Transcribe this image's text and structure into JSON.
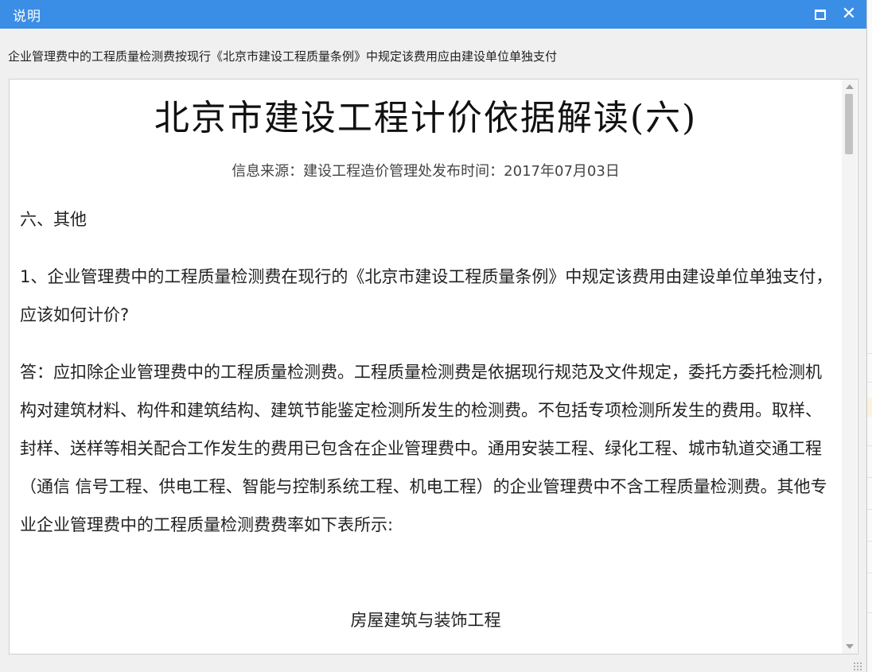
{
  "window": {
    "title": "说明",
    "maximize_icon": "maximize-icon",
    "close_icon": "close-icon",
    "close_glyph": "✕"
  },
  "description": "企业管理费中的工程质量检测费按现行《北京市建设工程质量条例》中规定该费用应由建设单位单独支付",
  "document": {
    "title": "北京市建设工程计价依据解读(六)",
    "source": "信息来源：建设工程造价管理处发布时间：2017年07月03日",
    "section": "六、其他",
    "question": "1、企业管理费中的工程质量检测费在现行的《北京市建设工程质量条例》中规定该费用由建设单位单独支付，应该如何计价?",
    "answer": "答：应扣除企业管理费中的工程质量检测费。工程质量检测费是依据现行规范及文件规定，委托方委托检测机构对建筑材料、构件和建筑结构、建筑节能鉴定检测所发生的检测费。不包括专项检测所发生的费用。取样、封样、送样等相关配合工作发生的费用已包含在企业管理费中。通用安装工程、绿化工程、城市轨道交通工程（通信 信号工程、供电工程、智能与控制系统工程、机电工程）的企业管理费中不含工程质量检测费。其他专业企业管理费中的工程质量检测费费率如下表所示:",
    "table_title": "房屋建筑与装饰工程"
  },
  "colors": {
    "titlebar": "#3a8ee6",
    "background": "#f0f0f0",
    "content": "#ffffff"
  }
}
